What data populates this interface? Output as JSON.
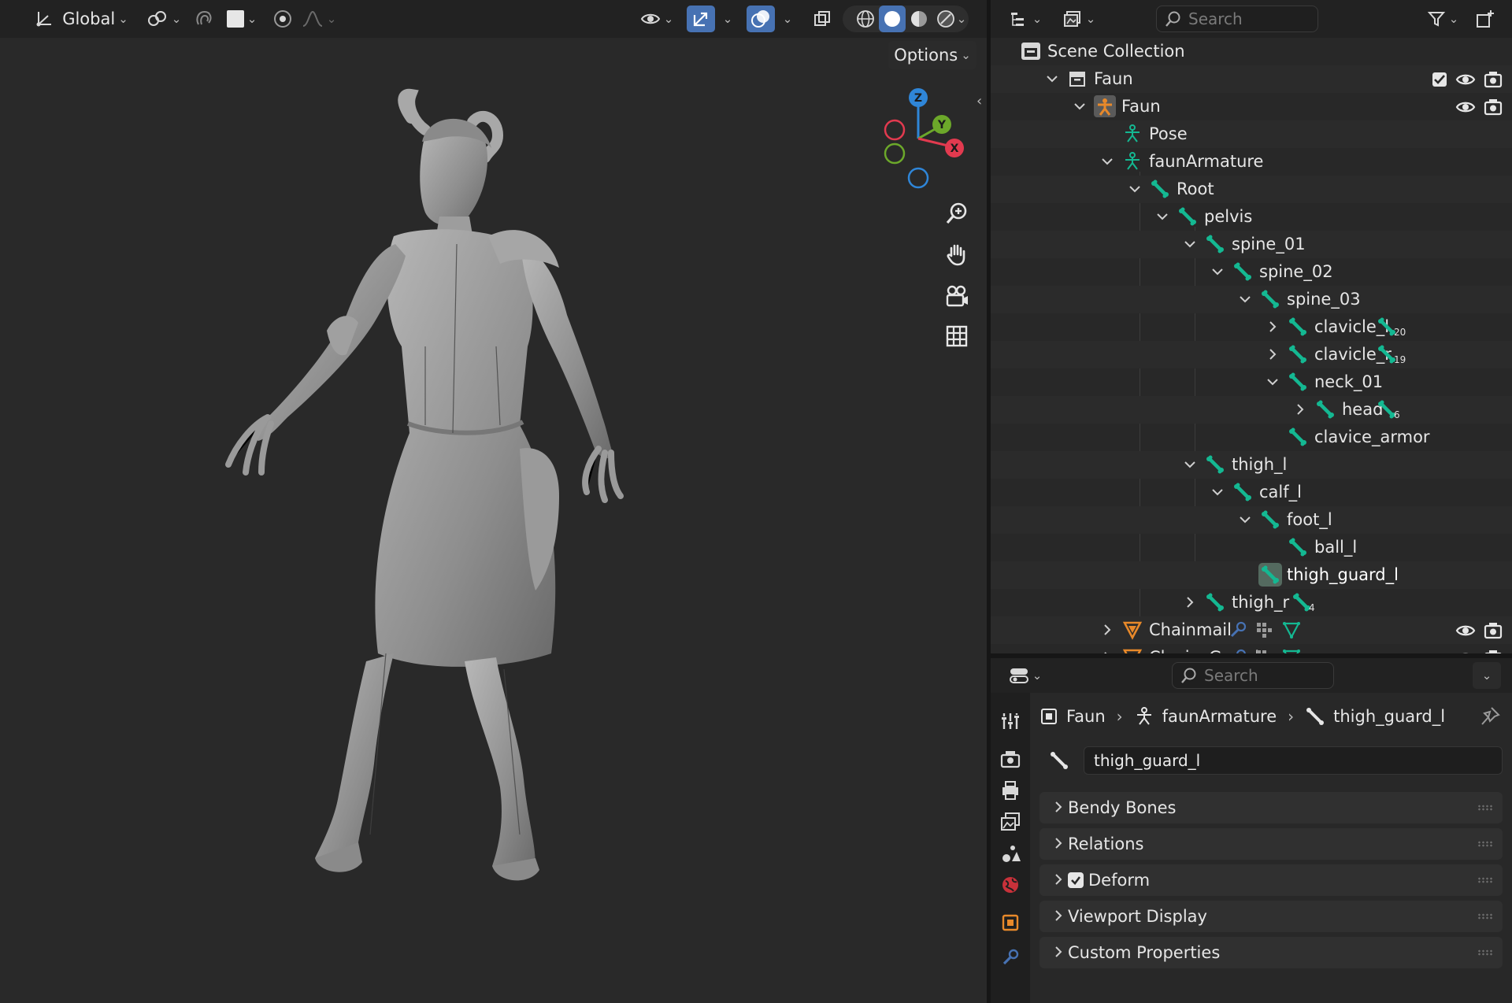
{
  "viewport": {
    "header": {
      "orientation_label": "Global"
    },
    "options_label": "Options",
    "gizmo_axes": {
      "z": "Z",
      "y": "Y",
      "x": "X"
    }
  },
  "outliner": {
    "search_placeholder": "Search",
    "rows": [
      {
        "label": "Scene Collection",
        "icon": "scene-collection-icon"
      },
      {
        "label": "Faun",
        "icon": "collection-icon"
      },
      {
        "label": "Faun",
        "icon": "armature-object-icon"
      },
      {
        "label": "Pose",
        "icon": "pose-icon"
      },
      {
        "label": "faunArmature",
        "icon": "armature-data-icon"
      },
      {
        "label": "Root",
        "icon": "bone-icon"
      },
      {
        "label": "pelvis",
        "icon": "bone-icon"
      },
      {
        "label": "spine_01",
        "icon": "bone-icon"
      },
      {
        "label": "spine_02",
        "icon": "bone-icon"
      },
      {
        "label": "spine_03",
        "icon": "bone-icon"
      },
      {
        "label": "clavicle_l",
        "icon": "bone-icon",
        "child_count": "20"
      },
      {
        "label": "clavicle_r",
        "icon": "bone-icon",
        "child_count": "19"
      },
      {
        "label": "neck_01",
        "icon": "bone-icon"
      },
      {
        "label": "head",
        "icon": "bone-icon",
        "child_count": "6"
      },
      {
        "label": "clavice_armor",
        "icon": "bone-icon"
      },
      {
        "label": "thigh_l",
        "icon": "bone-icon"
      },
      {
        "label": "calf_l",
        "icon": "bone-icon"
      },
      {
        "label": "foot_l",
        "icon": "bone-icon"
      },
      {
        "label": "ball_l",
        "icon": "bone-icon"
      },
      {
        "label": "thigh_guard_l",
        "icon": "bone-icon",
        "active": true
      },
      {
        "label": "thigh_r",
        "icon": "bone-icon",
        "child_count": "4"
      },
      {
        "label": "Chainmail",
        "icon": "mesh-icon"
      },
      {
        "label": "ClaviceGuard",
        "icon": "mesh-icon"
      }
    ]
  },
  "properties": {
    "search_placeholder": "Search",
    "breadcrumb": [
      "Faun",
      "faunArmature",
      "thigh_guard_l"
    ],
    "bone_name": "thigh_guard_l",
    "panels": [
      {
        "label": "Bendy Bones",
        "checkbox": false
      },
      {
        "label": "Relations",
        "checkbox": false
      },
      {
        "label": "Deform",
        "checkbox": true,
        "checked": true
      },
      {
        "label": "Viewport Display",
        "checkbox": false
      },
      {
        "label": "Custom Properties",
        "checkbox": false
      }
    ]
  },
  "colors": {
    "accent_blue": "#4772b3",
    "bone_green": "#14b892",
    "object_orange": "#e8892a",
    "axis_x": "#e23a4f",
    "axis_y": "#6ca82a",
    "axis_z": "#2f86d8"
  }
}
